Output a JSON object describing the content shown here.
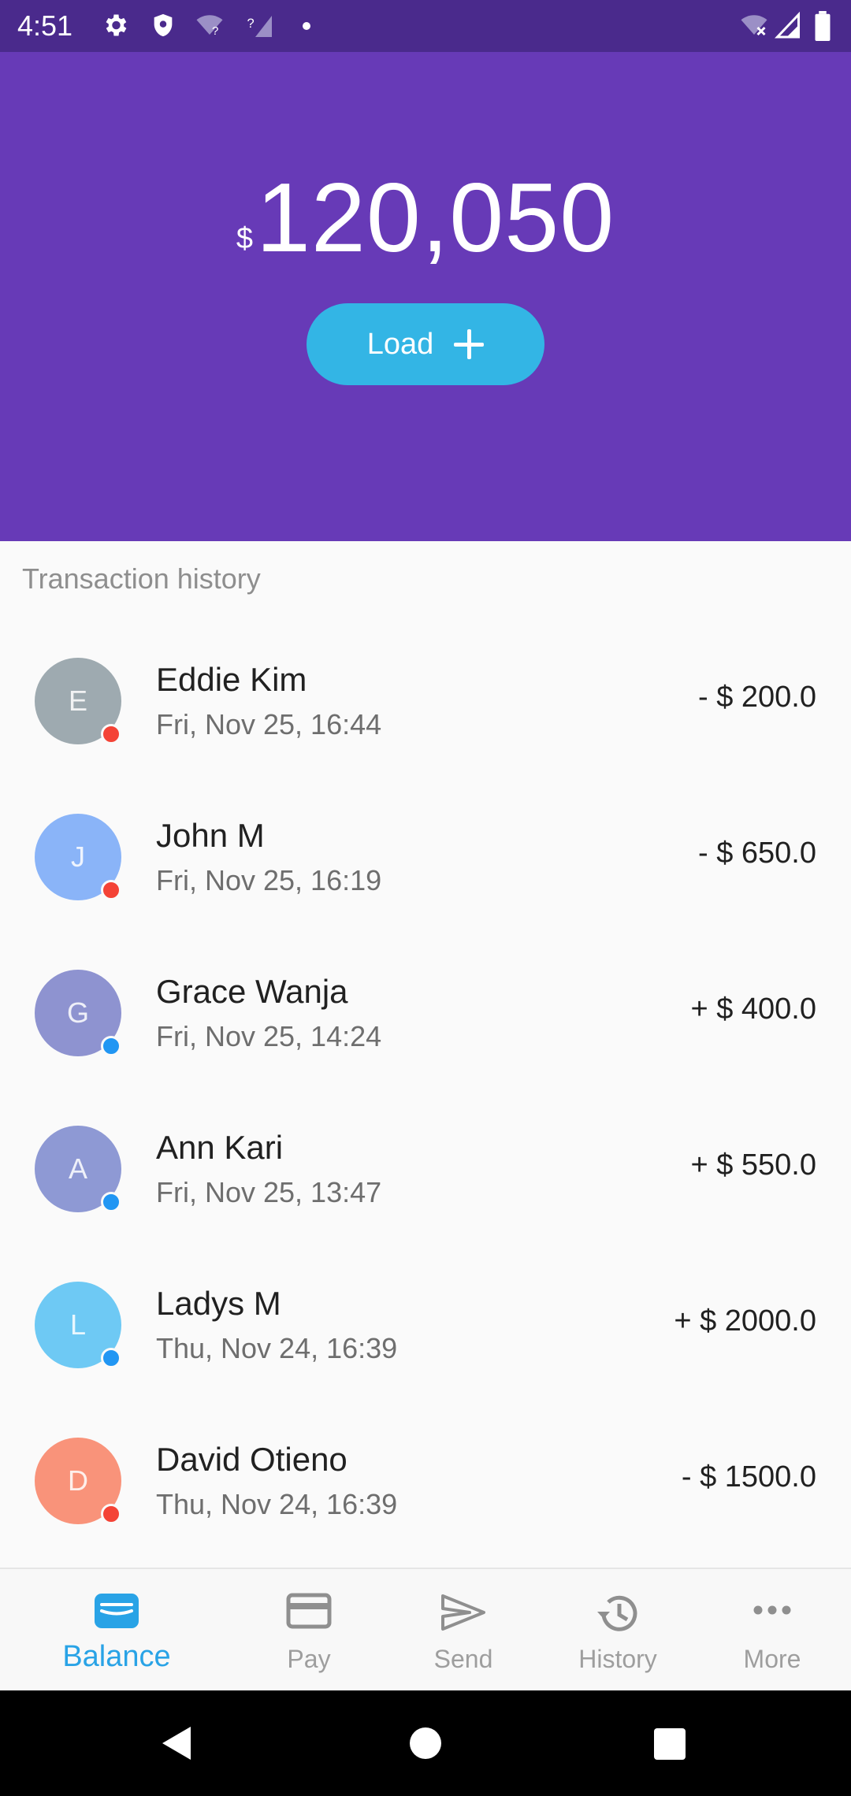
{
  "status_bar": {
    "time": "4:51",
    "icons": [
      "settings-icon",
      "shield-icon",
      "wifi-question-icon",
      "signal-question-icon",
      "notification-dot-icon",
      "wifi-off-icon",
      "cell-signal-icon",
      "battery-icon"
    ]
  },
  "header": {
    "currency_symbol": "$",
    "balance": "120,050",
    "load_label": "Load",
    "background_color": "#673ab7",
    "load_button_color": "#33b5e5"
  },
  "history": {
    "title": "Transaction history",
    "transactions": [
      {
        "initial": "E",
        "name": "Eddie Kim",
        "date": "Fri, Nov 25, 16:44",
        "amount": "- $ 200.0",
        "avatar_color": "#9eaab0",
        "direction": "out",
        "dot_color": "#f44336"
      },
      {
        "initial": "J",
        "name": "John M",
        "date": "Fri, Nov 25, 16:19",
        "amount": "- $ 650.0",
        "avatar_color": "#8ab4f8",
        "direction": "out",
        "dot_color": "#f44336"
      },
      {
        "initial": "G",
        "name": "Grace Wanja",
        "date": "Fri, Nov 25, 14:24",
        "amount": "+ $ 400.0",
        "avatar_color": "#8e93d0",
        "direction": "in",
        "dot_color": "#2196f3"
      },
      {
        "initial": "A",
        "name": "Ann Kari",
        "date": "Fri, Nov 25, 13:47",
        "amount": "+ $ 550.0",
        "avatar_color": "#8e99d4",
        "direction": "in",
        "dot_color": "#2196f3"
      },
      {
        "initial": "L",
        "name": "Ladys M",
        "date": "Thu, Nov 24, 16:39",
        "amount": "+ $ 2000.0",
        "avatar_color": "#6ec9f4",
        "direction": "in",
        "dot_color": "#2196f3"
      },
      {
        "initial": "D",
        "name": "David Otieno",
        "date": "Thu, Nov 24, 16:39",
        "amount": "- $ 1500.0",
        "avatar_color": "#f9937a",
        "direction": "out",
        "dot_color": "#f44336"
      }
    ]
  },
  "bottom_nav": {
    "items": [
      {
        "label": "Balance",
        "icon": "wallet-icon",
        "active": true
      },
      {
        "label": "Pay",
        "icon": "credit-card-icon",
        "active": false
      },
      {
        "label": "Send",
        "icon": "send-icon",
        "active": false
      },
      {
        "label": "History",
        "icon": "history-icon",
        "active": false
      },
      {
        "label": "More",
        "icon": "more-horizontal-icon",
        "active": false
      }
    ],
    "active_color": "#29a3e6"
  },
  "system_nav": {
    "icons": [
      "back-icon",
      "home-icon",
      "recents-icon"
    ]
  }
}
